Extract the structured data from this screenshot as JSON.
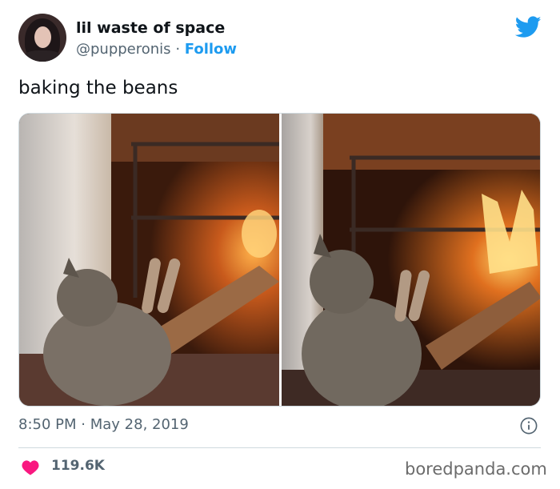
{
  "author": {
    "display_name": "lil waste of space",
    "handle": "@pupperonis",
    "separator": "·",
    "follow_label": "Follow"
  },
  "tweet": {
    "text": "baking the beans",
    "time": "8:50 PM",
    "date": "May 28, 2019",
    "meta_separator": "·",
    "likes": "119.6K"
  },
  "icons": {
    "brand": "twitter-bird-icon",
    "info": "info-icon",
    "like": "heart-icon"
  },
  "colors": {
    "accent": "#1d9bf0",
    "heart": "#f91880",
    "secondary_text": "#536471"
  },
  "watermark": "boredpanda.com"
}
